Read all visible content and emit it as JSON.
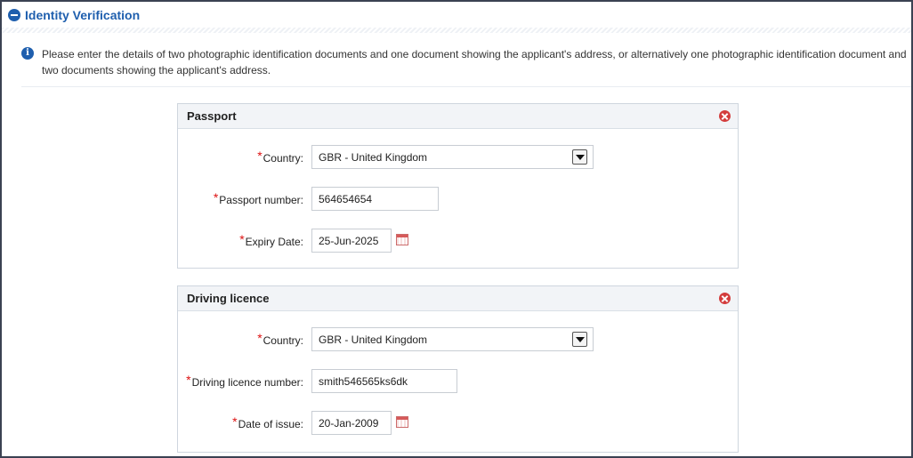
{
  "section": {
    "title": "Identity Verification",
    "info": "Please enter the details of two photographic identification documents and one document showing the applicant's address, or alternatively one photographic identification document and two documents showing the applicant's address."
  },
  "passport": {
    "title": "Passport",
    "country_label": "Country:",
    "country_value": "GBR - United Kingdom",
    "number_label": "Passport number:",
    "number_value": "564654654",
    "date_label": "Expiry Date:",
    "date_value": "25-Jun-2025"
  },
  "licence": {
    "title": "Driving licence",
    "country_label": "Country:",
    "country_value": "GBR - United Kingdom",
    "number_label": "Driving licence number:",
    "number_value": "smith546565ks6dk",
    "date_label": "Date of issue:",
    "date_value": "20-Jan-2009"
  },
  "required_marker": "*",
  "colors": {
    "accent": "#1f5fae",
    "required": "#dd1111",
    "remove": "#d33c3c"
  },
  "icons": [
    "collapse-icon",
    "info-icon",
    "remove-icon",
    "chevron-down-icon",
    "calendar-icon"
  ]
}
